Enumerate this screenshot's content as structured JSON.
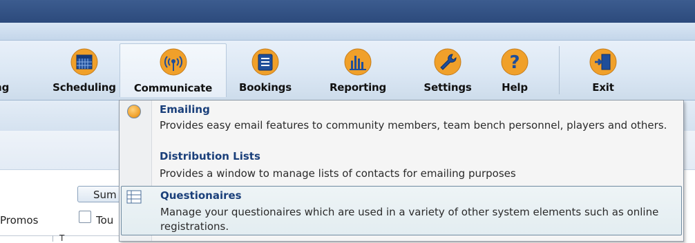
{
  "ribbon": {
    "partial_label": "ng",
    "buttons": [
      {
        "label": "Scheduling",
        "icon": "calendar-icon"
      },
      {
        "label": "Communicate",
        "icon": "antenna-icon"
      },
      {
        "label": "Bookings",
        "icon": "book-icon"
      },
      {
        "label": "Reporting",
        "icon": "bar-chart-icon"
      },
      {
        "label": "Settings",
        "icon": "wrench-icon"
      },
      {
        "label": "Help",
        "icon": "question-icon"
      },
      {
        "label": "Exit",
        "icon": "exit-door-icon"
      }
    ]
  },
  "background": {
    "button_partial": "Sum",
    "promos_label": "Promos",
    "checkbox_partial": "Tou",
    "column_mark": "T"
  },
  "dropdown": {
    "items": [
      {
        "title": "Emailing",
        "description": "Provides easy email features to community members, team bench personnel, players and others.",
        "icon": "globe-icon"
      },
      {
        "title": "Distribution Lists",
        "description": "Provides a window to manage lists of contacts for emailing purposes",
        "icon": ""
      },
      {
        "title": "Questionaires",
        "description": "Manage your questionaires which are used in a variety of other system elements such as online registrations.",
        "icon": "form-list-icon"
      }
    ]
  },
  "colors": {
    "title_bar": "#2c4a7c",
    "icon_orange": "#f0a02a",
    "item_title": "#1a3f7a"
  }
}
